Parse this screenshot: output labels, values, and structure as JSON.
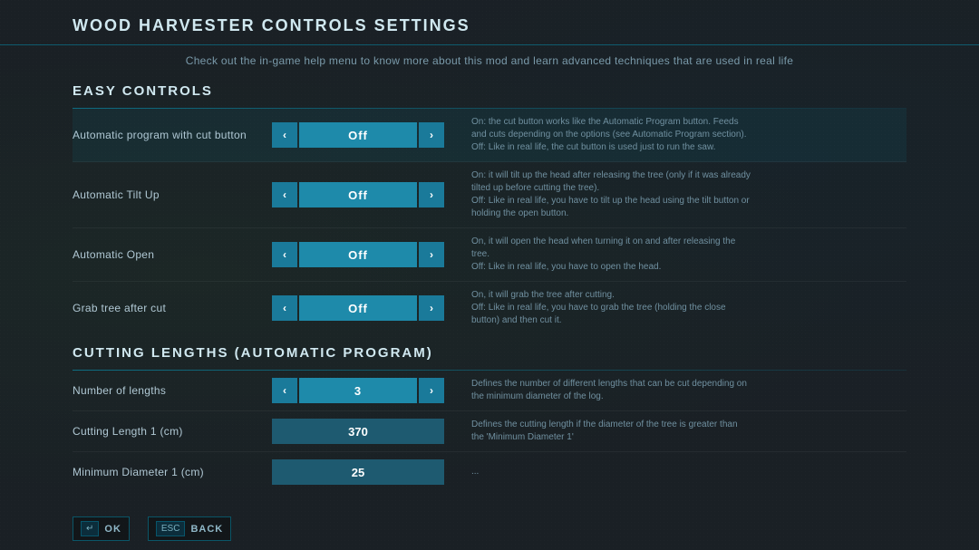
{
  "header": {
    "title": "WOOD HARVESTER CONTROLS SETTINGS",
    "subtitle": "Check out the in-game help menu to know more about this mod and learn advanced techniques that are used in real life"
  },
  "easy_controls": {
    "section_title": "EASY CONTROLS",
    "settings": [
      {
        "label": "Automatic program with cut button",
        "value": "Off",
        "description": "On: the cut button works like the Automatic Program button. Feeds and cuts depending on the options (see Automatic Program section).\nOff: Like in real life, the cut button is used just to run the saw.",
        "highlighted": true
      },
      {
        "label": "Automatic Tilt Up",
        "value": "Off",
        "description": "On: it will tilt up the head after releasing the tree (only if it was already tilted up before cutting the tree).\nOff: Like in real life, you have to tilt up the head using the tilt button or holding the open button.",
        "highlighted": false
      },
      {
        "label": "Automatic Open",
        "value": "Off",
        "description": "On, it will open the head when turning it on and after releasing the tree.\nOff: Like in real life, you have to open the head.",
        "highlighted": false
      },
      {
        "label": "Grab tree after cut",
        "value": "Off",
        "description": "On, it will grab the tree after cutting.\nOff: Like in real life, you have to grab the tree (holding the close button) and then cut it.",
        "highlighted": false
      }
    ]
  },
  "cutting_lengths": {
    "section_title": "CUTTING LENGTHS (AUTOMATIC PROGRAM)",
    "settings": [
      {
        "label": "Number of lengths",
        "value": "3",
        "has_arrows": true,
        "description": "Defines the number of different lengths that can be cut depending on the minimum diameter of the log."
      },
      {
        "label": "Cutting Length 1 (cm)",
        "value": "370",
        "has_arrows": false,
        "description": "Defines the cutting length if the diameter of the tree is greater than the 'Minimum Diameter 1'"
      },
      {
        "label": "Minimum Diameter 1 (cm)",
        "value": "25",
        "has_arrows": false,
        "description": "..."
      }
    ]
  },
  "footer": {
    "ok_key": "↵",
    "ok_label": "OK",
    "back_key": "ESC",
    "back_label": "BACK"
  }
}
